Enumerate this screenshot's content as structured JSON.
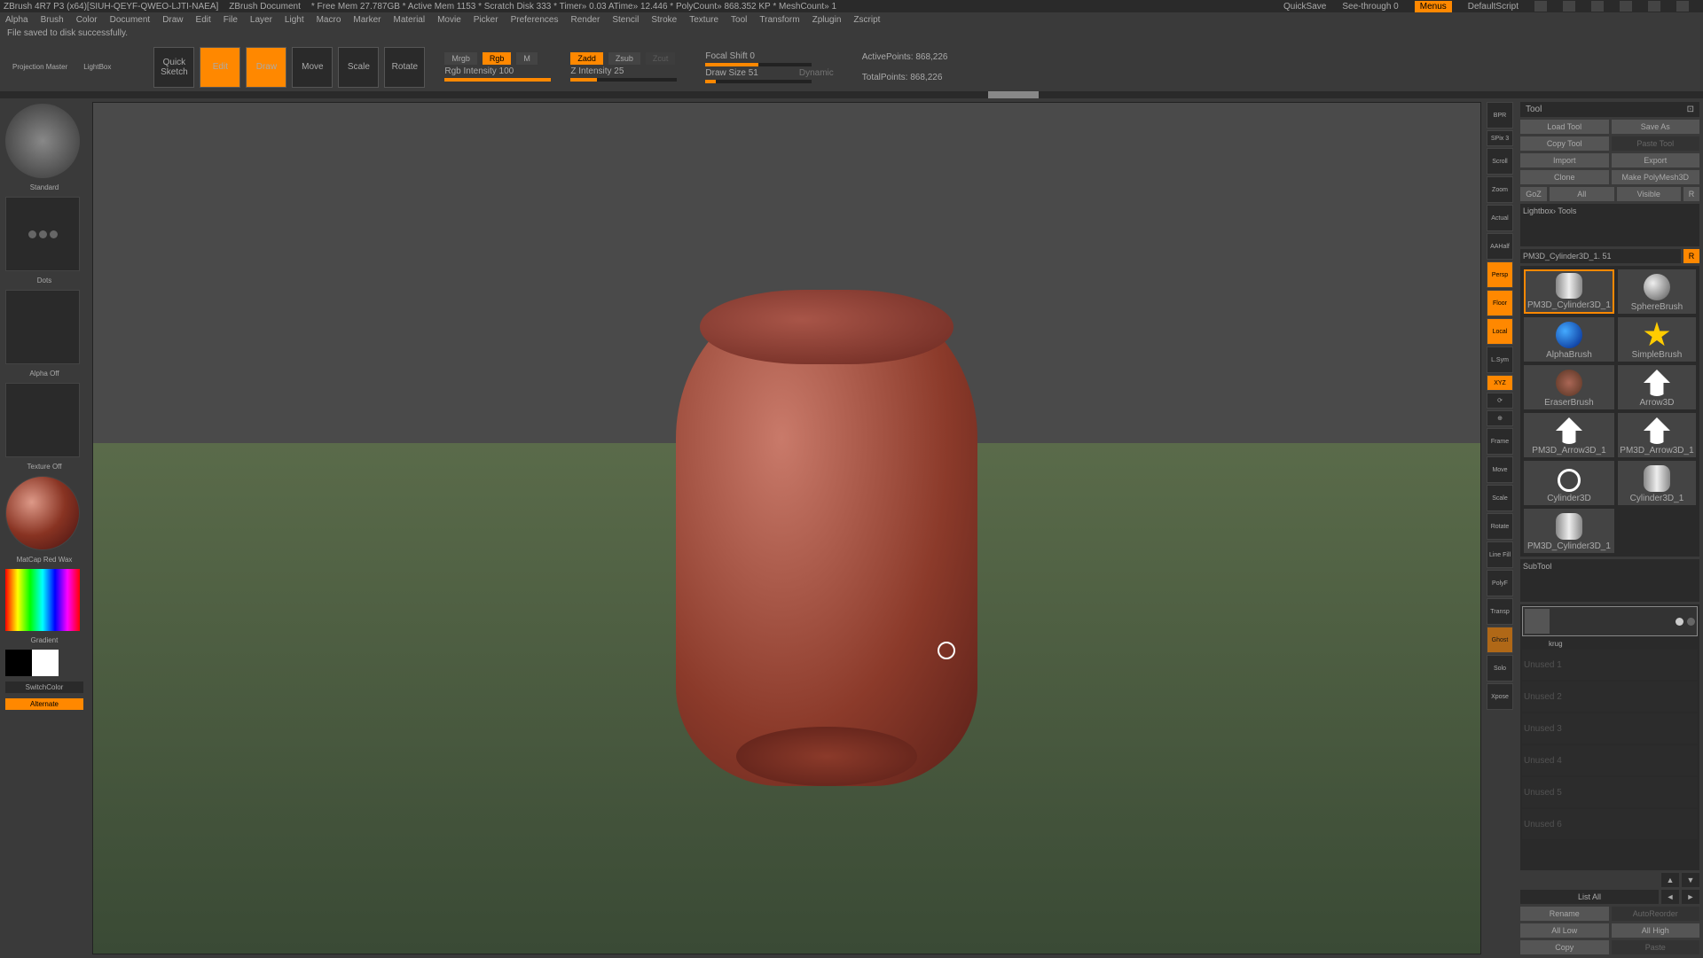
{
  "titlebar": {
    "app": "ZBrush 4R7 P3 (x64)[SIUH-QEYF-QWEO-LJTI-NAEA]",
    "doc": "ZBrush Document",
    "mem": "* Free Mem 27.787GB * Active Mem 1153 * Scratch Disk 333 * Timer» 0.03 ATime» 12.446 * PolyCount» 868.352 KP * MeshCount» 1",
    "quicksave": "QuickSave",
    "seethrough": "See-through  0",
    "menus": "Menus",
    "script": "DefaultScript"
  },
  "menu": [
    "Alpha",
    "Brush",
    "Color",
    "Document",
    "Draw",
    "Edit",
    "File",
    "Layer",
    "Light",
    "Macro",
    "Marker",
    "Material",
    "Movie",
    "Picker",
    "Preferences",
    "Render",
    "Stencil",
    "Stroke",
    "Texture",
    "Tool",
    "Transform",
    "Zplugin",
    "Zscript"
  ],
  "status": "File saved to disk successfully.",
  "toolbar": {
    "projection": "Projection Master",
    "lightbox": "LightBox",
    "quicksketch": "Quick Sketch",
    "edit": "Edit",
    "draw": "Draw",
    "move": "Move",
    "scale": "Scale",
    "rotate": "Rotate",
    "mrgb": "Mrgb",
    "rgb": "Rgb",
    "m": "M",
    "rgbintensity": "Rgb Intensity 100",
    "zadd": "Zadd",
    "zsub": "Zsub",
    "zcut": "Zcut",
    "zintensity": "Z Intensity 25",
    "focal": "Focal Shift 0",
    "drawsize": "Draw Size 51",
    "dynamic": "Dynamic",
    "active": "ActivePoints: 868,226",
    "total": "TotalPoints: 868,226"
  },
  "left": {
    "brush": "Standard",
    "stroke": "Dots",
    "alpha": "Alpha Off",
    "texture": "Texture Off",
    "material": "MatCap Red Wax",
    "gradient": "Gradient",
    "switchcolor": "SwitchColor",
    "alternate": "Alternate"
  },
  "rightbar": [
    "BPR",
    "SPix 3",
    "Scroll",
    "Zoom",
    "Actual",
    "AAHalf",
    "Persp",
    "Floor",
    "Local",
    "L.Sym",
    "XYZ",
    "⟳",
    "⊕",
    "Frame",
    "Move",
    "Scale",
    "Rotate",
    "Line Fill",
    "PolyF",
    "Transp",
    "Ghost",
    "Solo",
    "Xpose"
  ],
  "tool": {
    "header": "Tool",
    "load": "Load Tool",
    "saveas": "Save As",
    "copy": "Copy Tool",
    "paste": "Paste Tool",
    "import": "Import",
    "export": "Export",
    "clone": "Clone",
    "polymesh": "Make PolyMesh3D",
    "goz": "GoZ",
    "all": "All",
    "visible": "Visible",
    "r": "R",
    "lightbox": "Lightbox› Tools",
    "current": "PM3D_Cylinder3D_1. 51",
    "thumbs": [
      "PM3D_Cylinder3D_1",
      "SphereBrush",
      "AlphaBrush",
      "SimpleBrush",
      "EraserBrush",
      "Arrow3D",
      "PM3D_Arrow3D_1",
      "PM3D_Arrow3D_1",
      "Cylinder3D",
      "Cylinder3D_1",
      "PM3D_Cylinder3D_1"
    ]
  },
  "subtool": {
    "header": "SubTool",
    "active": "krug",
    "slots": [
      "Unused 1",
      "Unused 2",
      "Unused 3",
      "Unused 4",
      "Unused 5",
      "Unused 6"
    ],
    "listall": "List All",
    "rename": "Rename",
    "autoreorder": "AutoReorder",
    "alllow": "All Low",
    "allhigh": "All High",
    "copy2": "Copy",
    "paste2": "Paste"
  }
}
